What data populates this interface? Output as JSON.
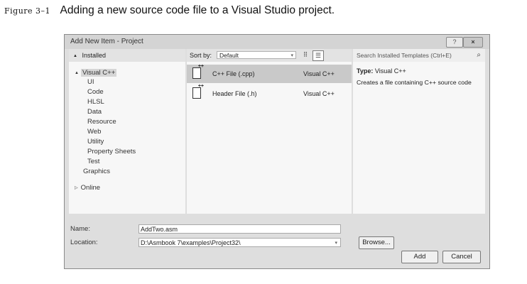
{
  "caption": {
    "figure_label": "Figure 3–1",
    "text": "Adding a new source code file to a Visual Studio project."
  },
  "dialog": {
    "title": "Add New Item - Project",
    "help_label": "?",
    "close_label": "×"
  },
  "left": {
    "header": "Installed",
    "tree": [
      "Visual C++",
      "UI",
      "Code",
      "HLSL",
      "Data",
      "Resource",
      "Web",
      "Utility",
      "Property Sheets",
      "Test",
      "Graphics"
    ],
    "online": "Online"
  },
  "middle": {
    "sort_label": "Sort by:",
    "sort_value": "Default",
    "templates": [
      {
        "name": "C++ File (.cpp)",
        "lang": "Visual C++"
      },
      {
        "name": "Header File (.h)",
        "lang": "Visual C++"
      }
    ]
  },
  "right": {
    "search_placeholder": "Search Installed Templates (Ctrl+E)",
    "type_label": "Type:",
    "type_value": "Visual C++",
    "description": "Creates a file containing C++ source code"
  },
  "bottom": {
    "name_label": "Name:",
    "name_value": "AddTwo.asm",
    "location_label": "Location:",
    "location_value": "D:\\Asmbook 7\\examples\\Project32\\",
    "browse_label": "Browse...",
    "add_label": "Add",
    "cancel_label": "Cancel"
  },
  "icons": {
    "expand": "▲",
    "collapsed": "▷",
    "dropdown": "▾",
    "search": "⌕"
  }
}
